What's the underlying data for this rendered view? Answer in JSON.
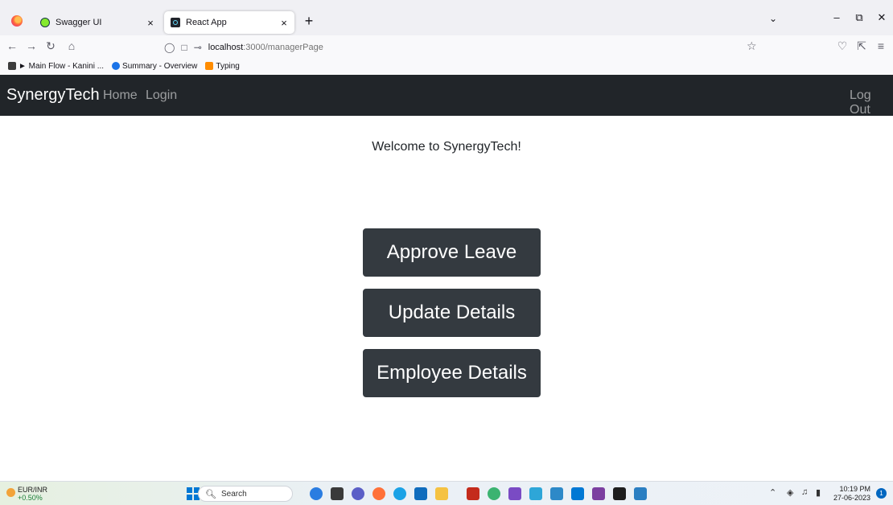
{
  "browser": {
    "tabs": [
      {
        "title": "Swagger UI",
        "active": false
      },
      {
        "title": "React App",
        "active": true
      }
    ],
    "new_tab_symbol": "+",
    "close_symbol": "×",
    "address": {
      "host": "localhost",
      "path": ":3000/managerPage"
    },
    "bookmarks": [
      "► Main Flow - Kanini ...",
      "Summary - Overview",
      "Typing"
    ]
  },
  "app": {
    "brand": "SynergyTech",
    "nav_links": [
      "Home",
      "Login"
    ],
    "logout": "Log Out",
    "welcome": "Welcome to SynergyTech!",
    "buttons": [
      "Approve Leave",
      "Update Details",
      "Employee Details"
    ],
    "colors": {
      "navbar": "#212529",
      "button": "#343a40"
    }
  },
  "taskbar": {
    "stock_symbol": "EUR/INR",
    "stock_change": "+0.50%",
    "search_placeholder": "Search",
    "time": "10:19 PM",
    "date": "27-06-2023",
    "notification_count": "1"
  }
}
